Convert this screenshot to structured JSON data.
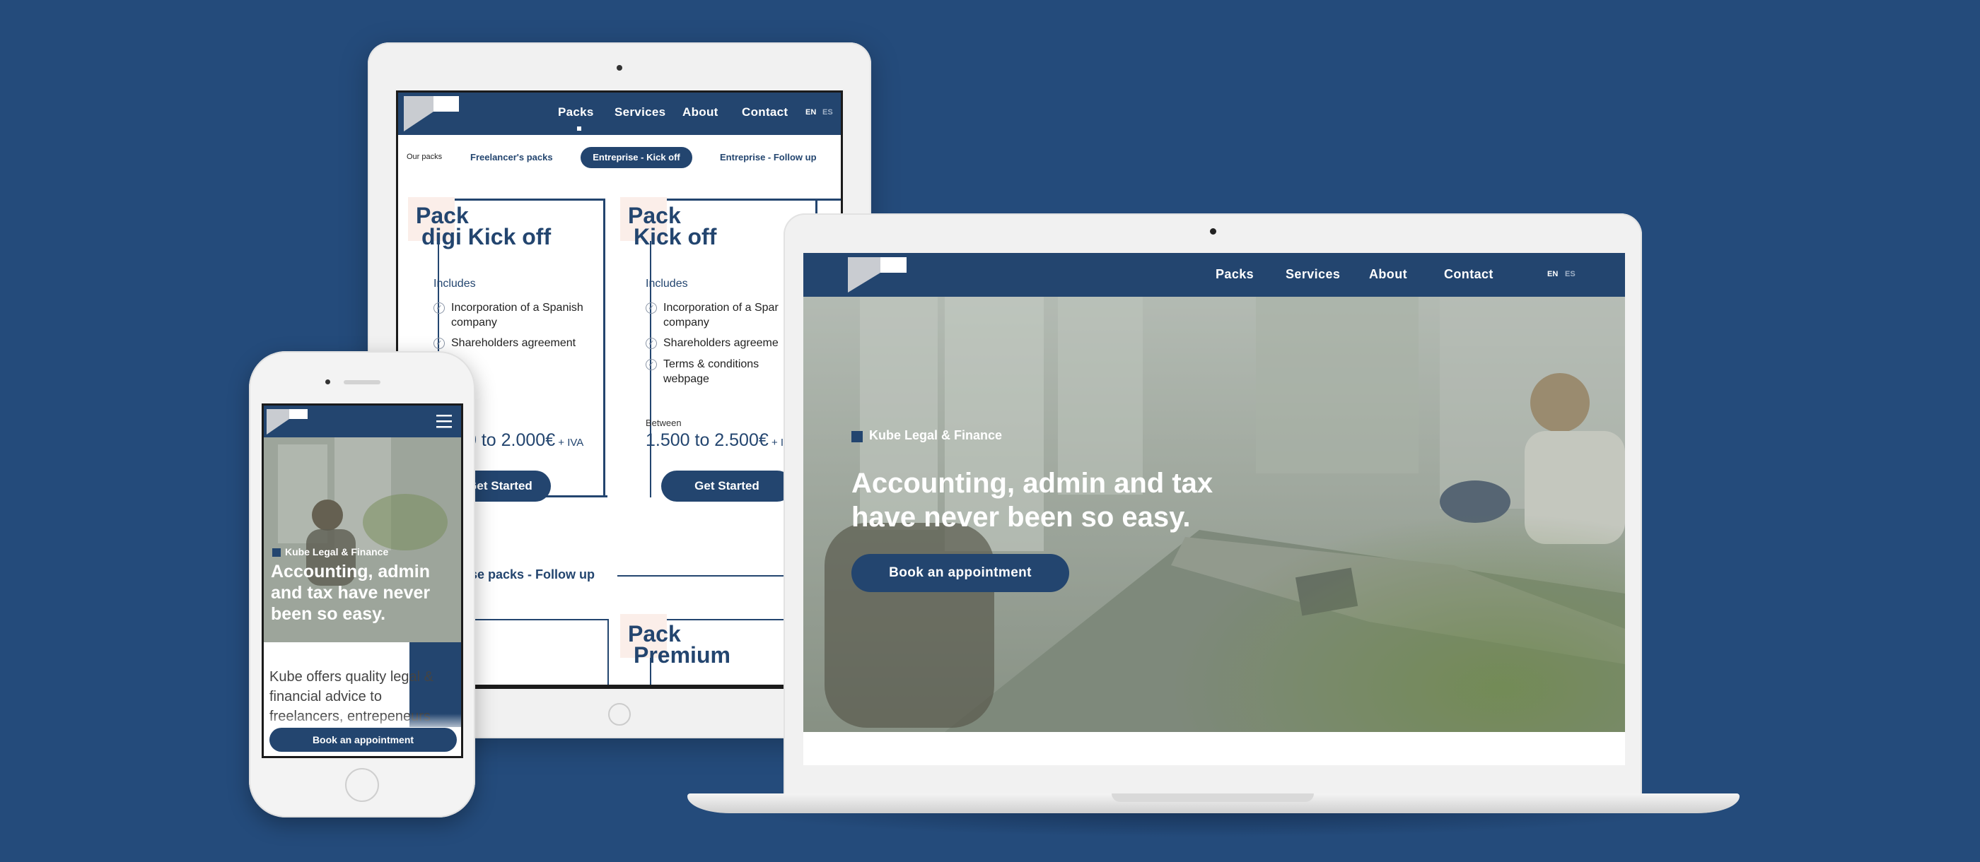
{
  "colors": {
    "background": "#244b7b",
    "brand_navy": "#23456f",
    "tag_pink": "#fbeee9",
    "logo_grey": "#c9ccd1"
  },
  "tablet": {
    "nav": {
      "items": [
        "Packs",
        "Services",
        "About",
        "Contact"
      ],
      "lang_en": "EN",
      "lang_es": "ES"
    },
    "tabs": {
      "label": "Our packs",
      "items": [
        "Freelancer's packs",
        "Entreprise - Kick off",
        "Entreprise - Follow up"
      ],
      "active": "Entreprise - Kick off"
    },
    "cards": [
      {
        "title_line1": "Pack",
        "title_line2": "digi Kick off",
        "includes_label": "Includes",
        "items": [
          "Incorporation of a Spanish company",
          "Shareholders agreement"
        ],
        "price_range": "0 to 2.000€",
        "price_suffix": " + IVA",
        "button": "Get Started"
      },
      {
        "title_line1": "Pack",
        "title_line2": "Kick off",
        "includes_label": "Includes",
        "items": [
          "Incorporation of a Spar company",
          "Shareholders agreeme",
          "Terms & conditions webpage"
        ],
        "between_label": "Between",
        "price_range": "1.500 to 2.500€",
        "price_suffix": " + I",
        "button": "Get Started"
      }
    ],
    "section_heading": "se packs - Follow up",
    "lower_left_fragment": ":",
    "lower_card": {
      "title_line1": "Pack",
      "title_line2": "Premium"
    }
  },
  "laptop": {
    "nav": {
      "items": [
        "Packs",
        "Services",
        "About",
        "Contact"
      ],
      "lang_en": "EN",
      "lang_es": "ES"
    },
    "hero": {
      "brand": "Kube Legal & Finance",
      "headline_line1": "Accounting, admin and tax",
      "headline_line2": "have never been so easy.",
      "cta": "Book an appointment"
    }
  },
  "phone": {
    "menu_icon": "hamburger-icon",
    "hero": {
      "brand": "Kube Legal & Finance",
      "headline_line1": "Accounting, admin",
      "headline_line2": "and tax have never",
      "headline_line3": "been so easy."
    },
    "body_line1": "Kube offers quality legal &",
    "body_line2": "financial advice to",
    "body_line3": "freelancers, entrepeneurs",
    "cta": "Book an appointment"
  }
}
